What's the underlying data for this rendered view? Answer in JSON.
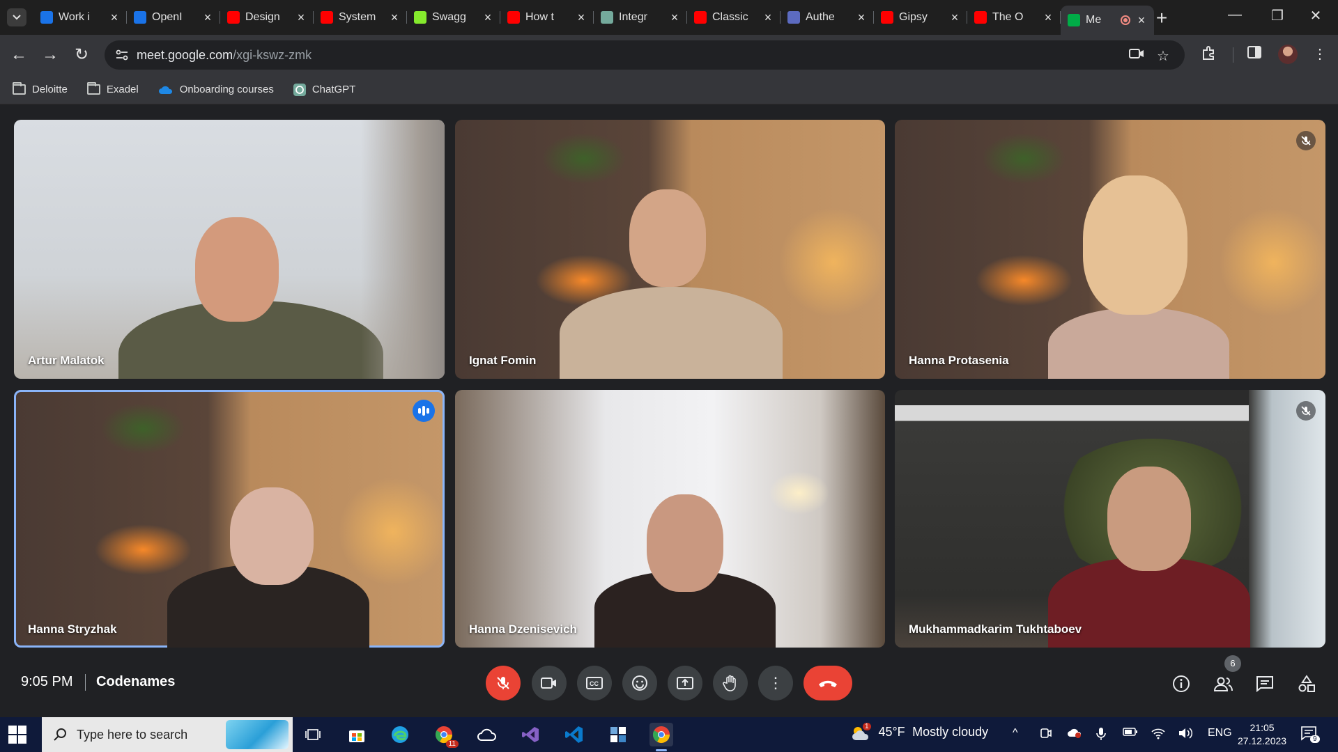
{
  "browser": {
    "tabs": [
      {
        "title": "Work i",
        "favicon_color": "#1a73e8",
        "favicon": "work-item-icon"
      },
      {
        "title": "OpenI",
        "favicon_color": "#1a73e8",
        "favicon": "openai-docs-icon"
      },
      {
        "title": "Design",
        "favicon_color": "#ff0000",
        "favicon": "youtube-icon"
      },
      {
        "title": "System",
        "favicon_color": "#ff0000",
        "favicon": "youtube-icon"
      },
      {
        "title": "Swagg",
        "favicon_color": "#85ea2d",
        "favicon": "swagger-icon"
      },
      {
        "title": "How t",
        "favicon_color": "#ff0000",
        "favicon": "youtube-icon"
      },
      {
        "title": "Integr",
        "favicon_color": "#74aa9c",
        "favicon": "chatgpt-icon"
      },
      {
        "title": "Classic",
        "favicon_color": "#ff0000",
        "favicon": "youtube-icon"
      },
      {
        "title": "Authe",
        "favicon_color": "#5c6bc0",
        "favicon": "auth-icon"
      },
      {
        "title": "Gipsy",
        "favicon_color": "#ff0000",
        "favicon": "youtube-icon"
      },
      {
        "title": "The O",
        "favicon_color": "#ff0000",
        "favicon": "youtube-icon"
      },
      {
        "title": "Me",
        "favicon_color": "#00ac47",
        "favicon": "meet-icon",
        "active": true
      }
    ],
    "url_host": "meet.google.com",
    "url_path": "/xgi-kswz-zmk",
    "bookmarks": [
      {
        "label": "Deloitte",
        "icon": "folder-icon"
      },
      {
        "label": "Exadel",
        "icon": "folder-icon"
      },
      {
        "label": "Onboarding courses",
        "icon": "onedrive-icon"
      },
      {
        "label": "ChatGPT",
        "icon": "chatgpt-icon"
      }
    ]
  },
  "participants": [
    {
      "name": "Artur Malatok",
      "muted": false,
      "speaking": false
    },
    {
      "name": "Ignat Fomin",
      "muted": false,
      "speaking": false
    },
    {
      "name": "Hanna Protasenia",
      "muted": true,
      "speaking": false
    },
    {
      "name": "Hanna Stryzhak",
      "muted": false,
      "speaking": true
    },
    {
      "name": "Hanna Dzenisevich",
      "muted": false,
      "speaking": false
    },
    {
      "name": "Mukhammadkarim Tukhtaboev",
      "muted": true,
      "speaking": false
    }
  ],
  "meeting": {
    "time": "9:05 PM",
    "title": "Codenames",
    "people_count": "6",
    "accent_red": "#ea4335"
  },
  "taskbar": {
    "search_placeholder": "Type here to search",
    "weather_temp": "45°F",
    "weather_desc": "Mostly cloudy",
    "weather_badge": "1",
    "lang": "ENG",
    "time": "21:05",
    "date": "27.12.2023",
    "notifications": "9",
    "app_badge": "11"
  }
}
